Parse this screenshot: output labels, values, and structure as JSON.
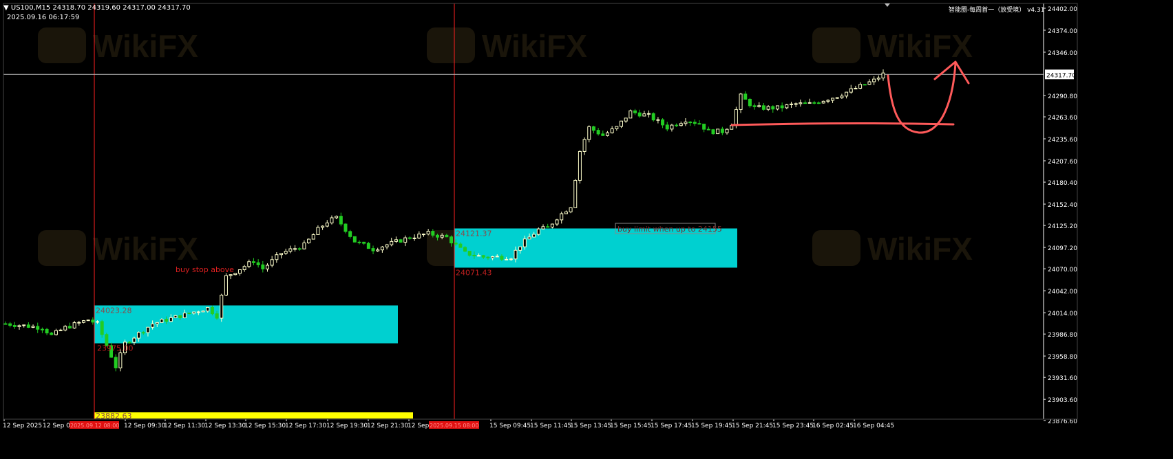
{
  "header": {
    "symbol_line": "US100,M15  24318.70 24319.60 24317.00 24317.70",
    "date": "2025.09.16 06:17:59",
    "indicator": "智能圈-每周首一（放受境） v4.31"
  },
  "watermark": "WikiFX",
  "chart_data": {
    "type": "candlestick",
    "symbol": "US100,M15",
    "ohlc_header": [
      24318.7,
      24319.6,
      24317.0,
      24317.7
    ],
    "current_price": 24317.7,
    "price_label": "24317.70",
    "ylim": [
      23876.6,
      24402.0
    ],
    "y_ticks": [
      "24402.00",
      "24374.00",
      "24346.00",
      "24317.70",
      "24290.80",
      "24263.60",
      "24235.60",
      "24207.60",
      "24180.40",
      "24152.40",
      "24125.20",
      "24097.20",
      "24070.00",
      "24042.00",
      "24014.00",
      "23986.80",
      "23958.80",
      "23931.60",
      "23903.60",
      "23876.60"
    ],
    "x_tick_labels": [
      "12 Sep 2025",
      "12 Sep 05:",
      "12 Sep 09:30",
      "12 Sep 11:30",
      "12 Sep 13:30",
      "12 Sep 15:30",
      "12 Sep 17:30",
      "12 Sep 19:30",
      "12 Sep 21:30",
      "12 Sep",
      "15 Sep 09:45",
      "15 Sep 11:45",
      "15 Sep 13:45",
      "15 Sep 15:45",
      "15 Sep 17:45",
      "15 Sep 19:45",
      "15 Sep 21:45",
      "15 Sep 23:45",
      "16 Sep 02:45",
      "16 Sep 04:45"
    ],
    "marked_times": [
      "2025.09.12 08:00",
      "2025.09.15 08:00"
    ],
    "zones": [
      {
        "top": 24023.28,
        "bottom": 23975.0,
        "top_label": "24023.28",
        "bottom_label": "23975.00",
        "color": "#00d0d0"
      },
      {
        "top": 24121.37,
        "bottom": 24071.43,
        "top_label": "24121.37",
        "bottom_label": "24071.43",
        "color": "#00d0d0"
      }
    ],
    "yellow_level": {
      "value": 23882.63,
      "label": "23882.63",
      "color": "#ffff00"
    },
    "annotations": [
      "buy stop above",
      "buy limit when up to 24155"
    ],
    "path": [
      [
        0,
        24000
      ],
      [
        8,
        23995
      ],
      [
        10,
        23985
      ],
      [
        13,
        23995
      ],
      [
        18,
        24005
      ],
      [
        20,
        24000
      ],
      [
        24,
        23945
      ],
      [
        26,
        23975
      ],
      [
        32,
        24000
      ],
      [
        38,
        24010
      ],
      [
        44,
        24020
      ],
      [
        46,
        24010
      ],
      [
        48,
        24060
      ],
      [
        54,
        24080
      ],
      [
        56,
        24070
      ],
      [
        60,
        24090
      ],
      [
        65,
        24100
      ],
      [
        68,
        24120
      ],
      [
        70,
        24130
      ],
      [
        72,
        24135
      ],
      [
        76,
        24105
      ],
      [
        80,
        24095
      ],
      [
        88,
        24110
      ],
      [
        92,
        24115
      ],
      [
        96,
        24110
      ],
      [
        100,
        24090
      ],
      [
        104,
        24085
      ],
      [
        110,
        24085
      ],
      [
        112,
        24100
      ],
      [
        114,
        24110
      ],
      [
        116,
        24120
      ],
      [
        118,
        24122
      ],
      [
        120,
        24135
      ],
      [
        123,
        24150
      ],
      [
        125,
        24220
      ],
      [
        127,
        24250
      ],
      [
        130,
        24240
      ],
      [
        133,
        24250
      ],
      [
        136,
        24270
      ],
      [
        140,
        24265
      ],
      [
        144,
        24250
      ],
      [
        148,
        24260
      ],
      [
        151,
        24255
      ],
      [
        153,
        24245
      ],
      [
        156,
        24245
      ],
      [
        158,
        24255
      ],
      [
        160,
        24290
      ],
      [
        163,
        24275
      ],
      [
        168,
        24275
      ],
      [
        172,
        24280
      ],
      [
        175,
        24280
      ],
      [
        178,
        24285
      ],
      [
        181,
        24290
      ],
      [
        185,
        24300
      ],
      [
        189,
        24310
      ],
      [
        191,
        24318
      ]
    ],
    "colors": {
      "bull": "#ffffcc",
      "bear": "#22cc22",
      "grid": "#1a1a1a",
      "axis": "#ffffff",
      "vline": "#ff2020",
      "drawing": "#ff5a5a",
      "priceline": "#c0c0c0"
    }
  }
}
